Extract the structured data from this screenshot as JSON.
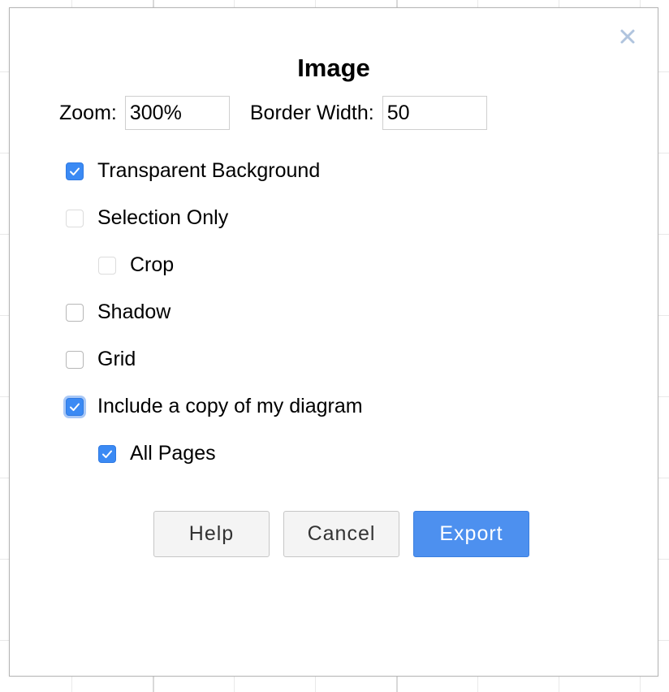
{
  "dialog": {
    "title": "Image",
    "zoom": {
      "label": "Zoom:",
      "value": "300%"
    },
    "border_width": {
      "label": "Border Width:",
      "value": "50"
    },
    "options": [
      {
        "key": "transparent_background",
        "label": "Transparent Background",
        "checked": true
      },
      {
        "key": "selection_only",
        "label": "Selection Only",
        "checked": false
      },
      {
        "key": "crop",
        "label": "Crop",
        "checked": false
      },
      {
        "key": "shadow",
        "label": "Shadow",
        "checked": false
      },
      {
        "key": "grid",
        "label": "Grid",
        "checked": false
      },
      {
        "key": "include_copy",
        "label": "Include a copy of my diagram",
        "checked": true
      },
      {
        "key": "all_pages",
        "label": "All Pages",
        "checked": true
      }
    ],
    "buttons": {
      "help": "Help",
      "cancel": "Cancel",
      "export": "Export"
    },
    "icons": {
      "close": "close-icon",
      "check": "checkmark-icon"
    },
    "colors": {
      "accent": "#4d90ef",
      "check_fill": "#3b8af4",
      "close_icon": "#b0c4de"
    }
  }
}
